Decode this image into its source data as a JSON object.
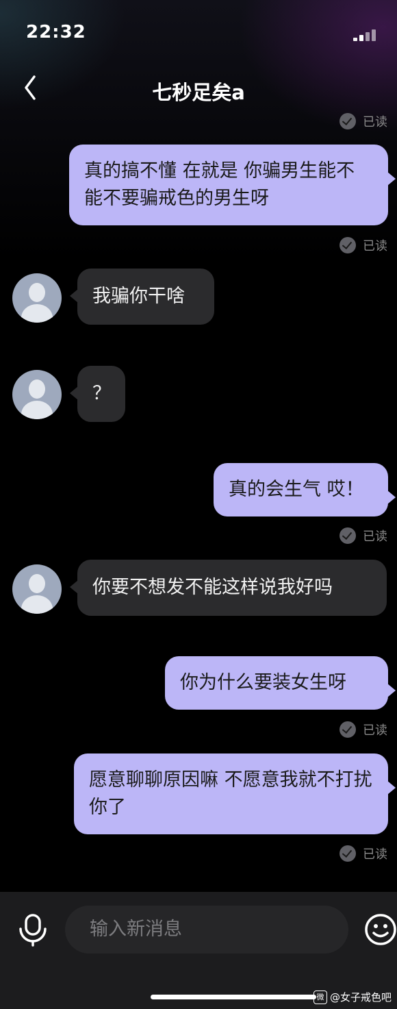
{
  "status_bar": {
    "time": "22:32"
  },
  "header": {
    "title": "七秒足矣a"
  },
  "read_label": "已读",
  "messages": [
    {
      "side": "sent",
      "text": "真的搞不懂 在就是 你骗男生能不能不要骗戒色的男生呀",
      "status": "已读"
    },
    {
      "side": "received",
      "text": "我骗你干啥"
    },
    {
      "side": "received",
      "text": "？"
    },
    {
      "side": "sent",
      "text": "真的会生气 哎！",
      "status": "已读"
    },
    {
      "side": "received",
      "text": "你要不想发不能这样说我好吗"
    },
    {
      "side": "sent",
      "text": "你为什么要装女生呀",
      "status": "已读"
    },
    {
      "side": "sent",
      "text": "愿意聊聊原因嘛 不愿意我就不打扰你了",
      "status": "已读"
    }
  ],
  "composer": {
    "placeholder": "输入新消息"
  },
  "watermark": {
    "text": "@女子戒色吧",
    "icon": "weibo-icon",
    "icon_glyph": "微"
  },
  "colors": {
    "sent_bubble": "#bcb6f7",
    "received_bubble": "#2b2b2d",
    "background": "#000000"
  }
}
